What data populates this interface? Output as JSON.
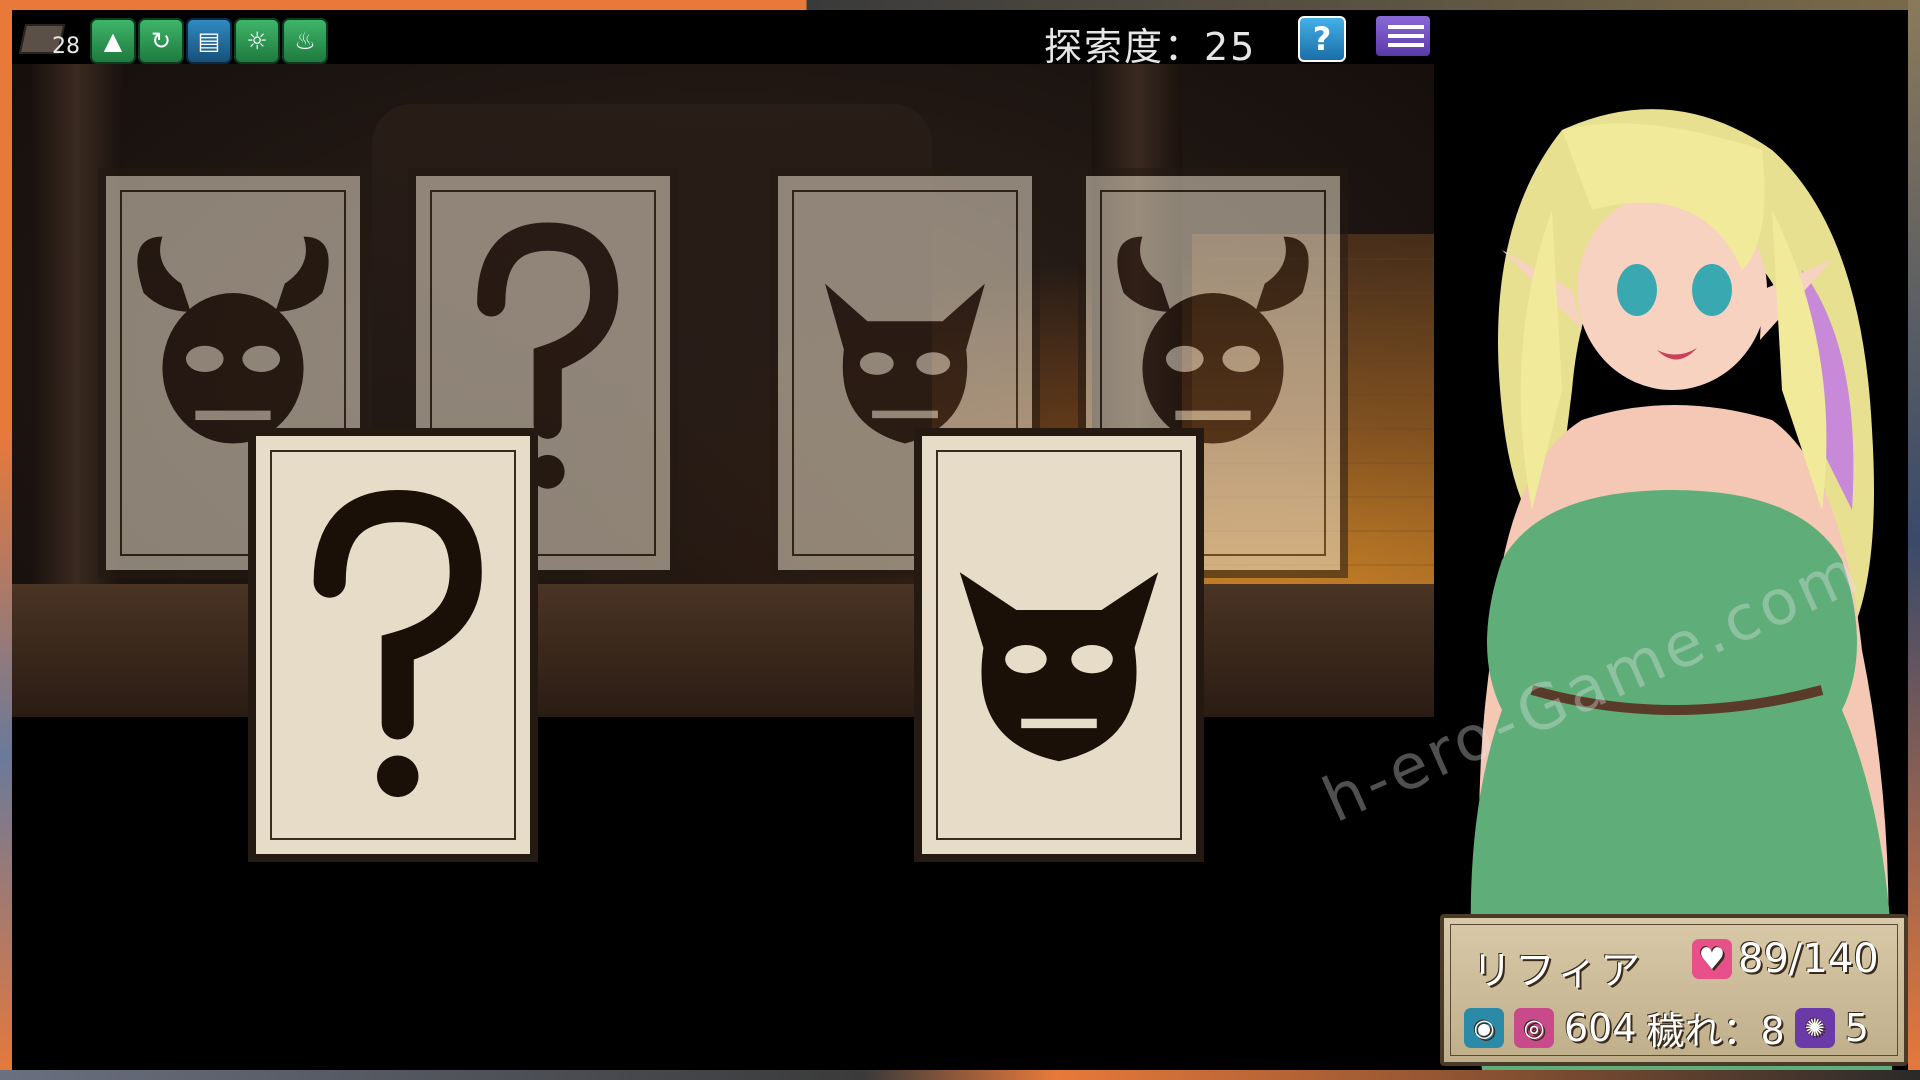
{
  "hud": {
    "deck_count": "28",
    "skills": [
      {
        "icon": "witch-hat-icon"
      },
      {
        "icon": "swirl-icon"
      },
      {
        "icon": "spellbook-icon"
      },
      {
        "icon": "sun-icon"
      },
      {
        "icon": "flame-icon"
      }
    ],
    "exploration_label": "探索度：25",
    "help_label": "?"
  },
  "cards": {
    "back_row": [
      {
        "icon": "horned-skull-icon"
      },
      {
        "icon": "question-mark-icon"
      },
      {
        "icon": "demon-skull-icon"
      },
      {
        "icon": "horned-skull-icon"
      }
    ],
    "front_row": [
      {
        "icon": "question-mark-icon",
        "symbol": "?"
      },
      {
        "icon": "demon-skull-icon"
      }
    ]
  },
  "watermark": "h-ero-Game.com",
  "status": {
    "name": "リフィア",
    "hp": "89/140",
    "gold": "604",
    "corruption": "穢れ：8",
    "level": "5"
  },
  "colors": {
    "card_bg": "#e7dcc8",
    "card_border": "#241a12",
    "skill_green": "#3fb56a",
    "heart_pink": "#e8508a"
  }
}
